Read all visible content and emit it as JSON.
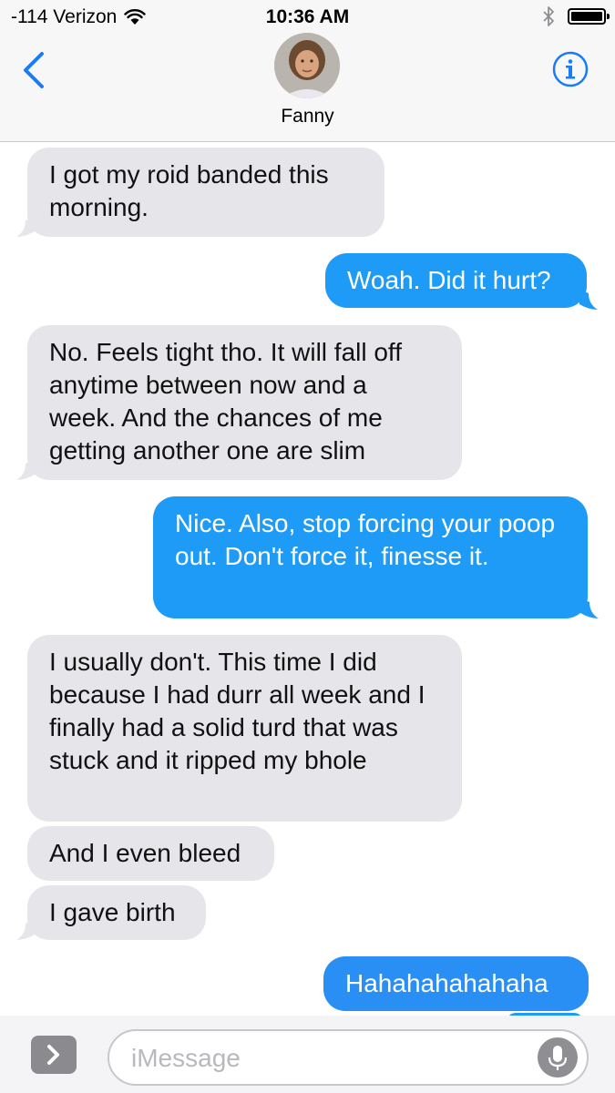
{
  "status_bar": {
    "carrier": "-114 Verizon",
    "time": "10:36 AM"
  },
  "header": {
    "contact_name": "Fanny"
  },
  "messages": [
    {
      "direction": "incoming",
      "text": "I got my roid banded this morning."
    },
    {
      "direction": "outgoing",
      "text": "Woah. Did it hurt?"
    },
    {
      "direction": "incoming",
      "text": "No. Feels tight tho. It will fall off anytime between now and a week. And the chances of me getting another one are slim"
    },
    {
      "direction": "outgoing",
      "text": "Nice. Also, stop forcing your poop out. Don't force it, finesse it."
    },
    {
      "direction": "incoming",
      "text": "I usually don't. This time I did because I had durr all week and I finally had a solid turd that was stuck and it ripped my bhole"
    },
    {
      "direction": "incoming",
      "text": "And I even bleed"
    },
    {
      "direction": "incoming",
      "text": "I gave birth"
    },
    {
      "direction": "outgoing",
      "text": "Hahahahahahaha"
    }
  ],
  "composer": {
    "placeholder": "iMessage"
  },
  "colors": {
    "incoming_bubble": "#e6e5ea",
    "outgoing_bubble": "#1e9bf6",
    "accent": "#1a7cf5"
  }
}
